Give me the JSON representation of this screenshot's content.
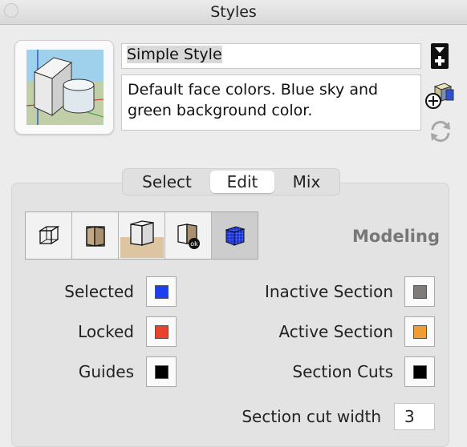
{
  "window": {
    "title": "Styles"
  },
  "style": {
    "name": "Simple Style",
    "description": "Default face colors. Blue sky and green background color."
  },
  "icons": {
    "thumbnail": "style-preview-thumbnail",
    "save": "save-as-new-style-icon",
    "create": "create-new-style-icon",
    "update": "update-style-icon"
  },
  "tabs": [
    "Select",
    "Edit",
    "Mix"
  ],
  "active_tab": "Edit",
  "toolbar": {
    "buttons": [
      "edge-settings",
      "face-settings",
      "background-settings",
      "watermark-settings",
      "modeling-settings"
    ],
    "active": "modeling-settings"
  },
  "modeling": {
    "title": "Modeling",
    "selected_label": "Selected",
    "selected_color": "#1a3ef0",
    "locked_label": "Locked",
    "locked_color": "#e8412c",
    "guides_label": "Guides",
    "guides_color": "#000000",
    "inactive_section_label": "Inactive Section",
    "inactive_section_color": "#7e7b78",
    "active_section_label": "Active Section",
    "active_section_color": "#f19b35",
    "section_cuts_label": "Section Cuts",
    "section_cuts_color": "#000000",
    "section_cut_width_label": "Section cut width",
    "section_cut_width": "3"
  }
}
